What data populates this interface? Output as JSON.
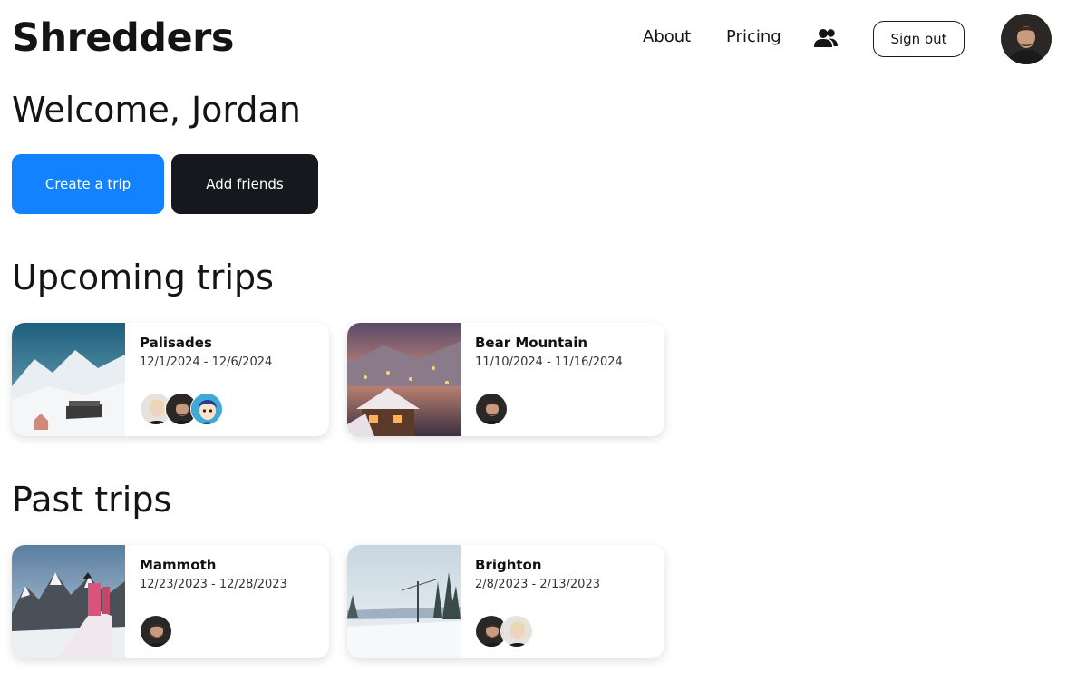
{
  "header": {
    "logo": "Shredders",
    "nav": {
      "about": "About",
      "pricing": "Pricing"
    },
    "friends_icon": "users-icon",
    "sign_out": "Sign out"
  },
  "welcome": "Welcome, Jordan",
  "actions": {
    "create_trip": "Create a trip",
    "add_friends": "Add friends"
  },
  "sections": {
    "upcoming": "Upcoming trips",
    "past": "Past trips"
  },
  "upcoming_trips": [
    {
      "name": "Palisades",
      "dates": "12/1/2024 - 12/6/2024"
    },
    {
      "name": "Bear Mountain",
      "dates": "11/10/2024 - 11/16/2024"
    }
  ],
  "past_trips": [
    {
      "name": "Mammoth",
      "dates": "12/23/2023 - 12/28/2023"
    },
    {
      "name": "Brighton",
      "dates": "2/8/2023 - 2/13/2023"
    }
  ],
  "colors": {
    "primary": "#1282ff",
    "dark": "#17181d",
    "text": "#141414"
  }
}
